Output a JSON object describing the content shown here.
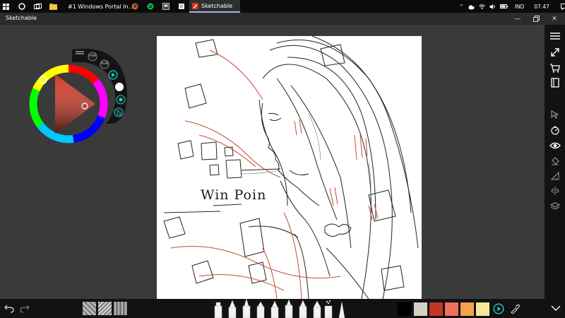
{
  "taskbar": {
    "apps": [
      {
        "label": "#1 Windows Portal In..."
      },
      {
        "label": "Sketchable"
      }
    ],
    "tray": {
      "language": "IND",
      "time": "07.47"
    }
  },
  "window": {
    "title": "Sketchable"
  },
  "canvas": {
    "handwriting": "Win Poin"
  },
  "color_widget": {
    "mode_buttons": [
      "HSB",
      "RGB"
    ]
  },
  "palette": {
    "colors": [
      "#000000",
      "#d4d1c6",
      "#c0381f",
      "#f07060",
      "#f4a24d",
      "#f6e79a"
    ]
  },
  "icons": {
    "accent": "#1fd1c4"
  }
}
